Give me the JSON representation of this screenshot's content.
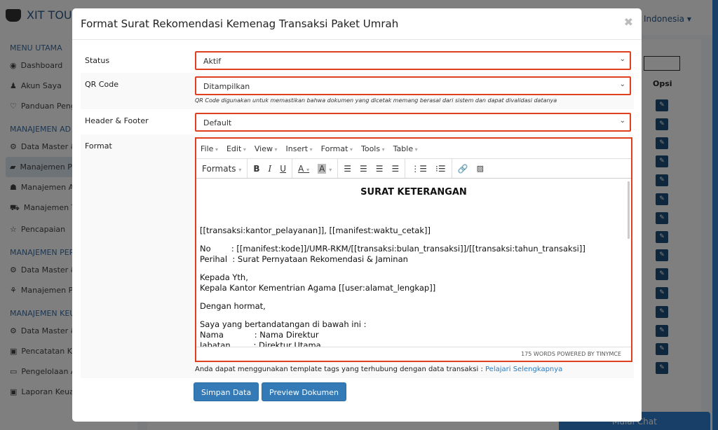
{
  "app": {
    "logo": "XIT TOUR",
    "language": "Indonesia ▾",
    "chat": "Mulai Chat"
  },
  "sidebar": {
    "sections": [
      {
        "title": "MENU UTAMA",
        "items": [
          "Dashboard",
          "Akun Saya",
          "Panduan Peng"
        ]
      },
      {
        "title": "MANAJEMEN AD",
        "items": [
          "Data Master &",
          "Manajemen P",
          "Manajemen A",
          "Manajemen T",
          "Pencapaian"
        ]
      },
      {
        "title": "MANAJEMEN PER",
        "items": [
          "Data Master &",
          "Manajemen P"
        ]
      },
      {
        "title": "MANAJEMEN KEU",
        "items": [
          "Data Master &",
          "Pencatatan K",
          "Pengelolaan A",
          "Laporan Keuangan"
        ]
      }
    ]
  },
  "table": {
    "column": "Opsi"
  },
  "modal": {
    "title": "Format Surat Rekomendasi Kemenag Transaksi Paket Umrah",
    "status": {
      "label": "Status",
      "value": "Aktif"
    },
    "qr": {
      "label": "QR Code",
      "value": "Ditampilkan",
      "help": "QR Code digunakan untuk memastikan bahwa dokumen yang dicetak memang berasal dari sistem dan dapat divalidasi datanya"
    },
    "hf": {
      "label": "Header & Footer",
      "value": "Default"
    },
    "format": {
      "label": "Format"
    },
    "editor": {
      "menu": [
        "File",
        "Edit",
        "View",
        "Insert",
        "Format",
        "Tools",
        "Table"
      ],
      "formats": "Formats",
      "content": {
        "title": "SURAT KETERANGAN",
        "l1": "[[transaksi:kantor_pelayanan]], [[manifest:waktu_cetak]]",
        "l2": "No        : [[manifest:kode]]/UMR-RKM/[[transaksi:bulan_transaksi]]/[[transaksi:tahun_transaksi]]",
        "l3": "Perihal  : Surat Pernyataan Rekomendasi & Jaminan",
        "l4": "Kepada Yth,",
        "l5": "Kepala Kantor Kementrian Agama [[user:alamat_lengkap]]",
        "l6": "Dengan hormat,",
        "l7": "Saya yang bertandatangan di bawah ini :",
        "l8": "Nama            : Nama Direktur",
        "l9": "Jabatan         : Direktur Utama"
      },
      "status": "175 WORDS POWERED BY TINYMCE"
    },
    "note": "Anda dapat menggunakan template tags yang terhubung dengan data transaksi : ",
    "note_link": "Pelajari Selengkapnya",
    "save": "Simpan Data",
    "preview": "Preview Dokumen"
  }
}
